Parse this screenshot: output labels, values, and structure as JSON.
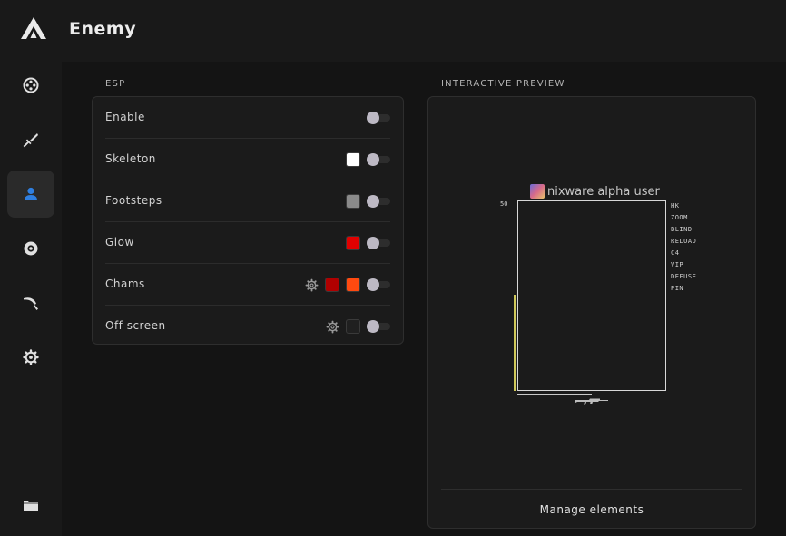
{
  "header": {
    "title": "Enemy"
  },
  "sidebar": {
    "items": [
      {
        "name": "aimbot",
        "icon": "crosshair-icon"
      },
      {
        "name": "weapons",
        "icon": "sword-icon"
      },
      {
        "name": "players",
        "icon": "user-icon",
        "active": true
      },
      {
        "name": "visuals",
        "icon": "eye-icon"
      },
      {
        "name": "skins",
        "icon": "knife-icon"
      },
      {
        "name": "settings",
        "icon": "gear-icon"
      },
      {
        "name": "configs",
        "icon": "folder-icon"
      }
    ]
  },
  "esp": {
    "section_label": "ESP",
    "rows": [
      {
        "label": "Enable",
        "colors": [],
        "has_gear": false,
        "enabled": false
      },
      {
        "label": "Skeleton",
        "colors": [
          "#ffffff"
        ],
        "has_gear": false,
        "enabled": false
      },
      {
        "label": "Footsteps",
        "colors": [
          "#8a8a8a"
        ],
        "has_gear": false,
        "enabled": false
      },
      {
        "label": "Glow",
        "colors": [
          "#e00000"
        ],
        "has_gear": false,
        "enabled": false
      },
      {
        "label": "Chams",
        "colors": [
          "#b00000",
          "#ff4a10"
        ],
        "has_gear": true,
        "enabled": false
      },
      {
        "label": "Off screen",
        "colors": [
          "#202020"
        ],
        "has_gear": true,
        "enabled": false
      }
    ]
  },
  "preview": {
    "section_label": "INTERACTIVE PREVIEW",
    "player_name": "nixware alpha user",
    "health_value": "50",
    "flags": [
      "HK",
      "ZOOM",
      "BLIND",
      "RELOAD",
      "C4",
      "VIP",
      "DEFUSE",
      "PIN"
    ],
    "health_color": "#cfc85a",
    "manage_button": "Manage elements"
  },
  "colors": {
    "accent": "#2f7fe0"
  }
}
